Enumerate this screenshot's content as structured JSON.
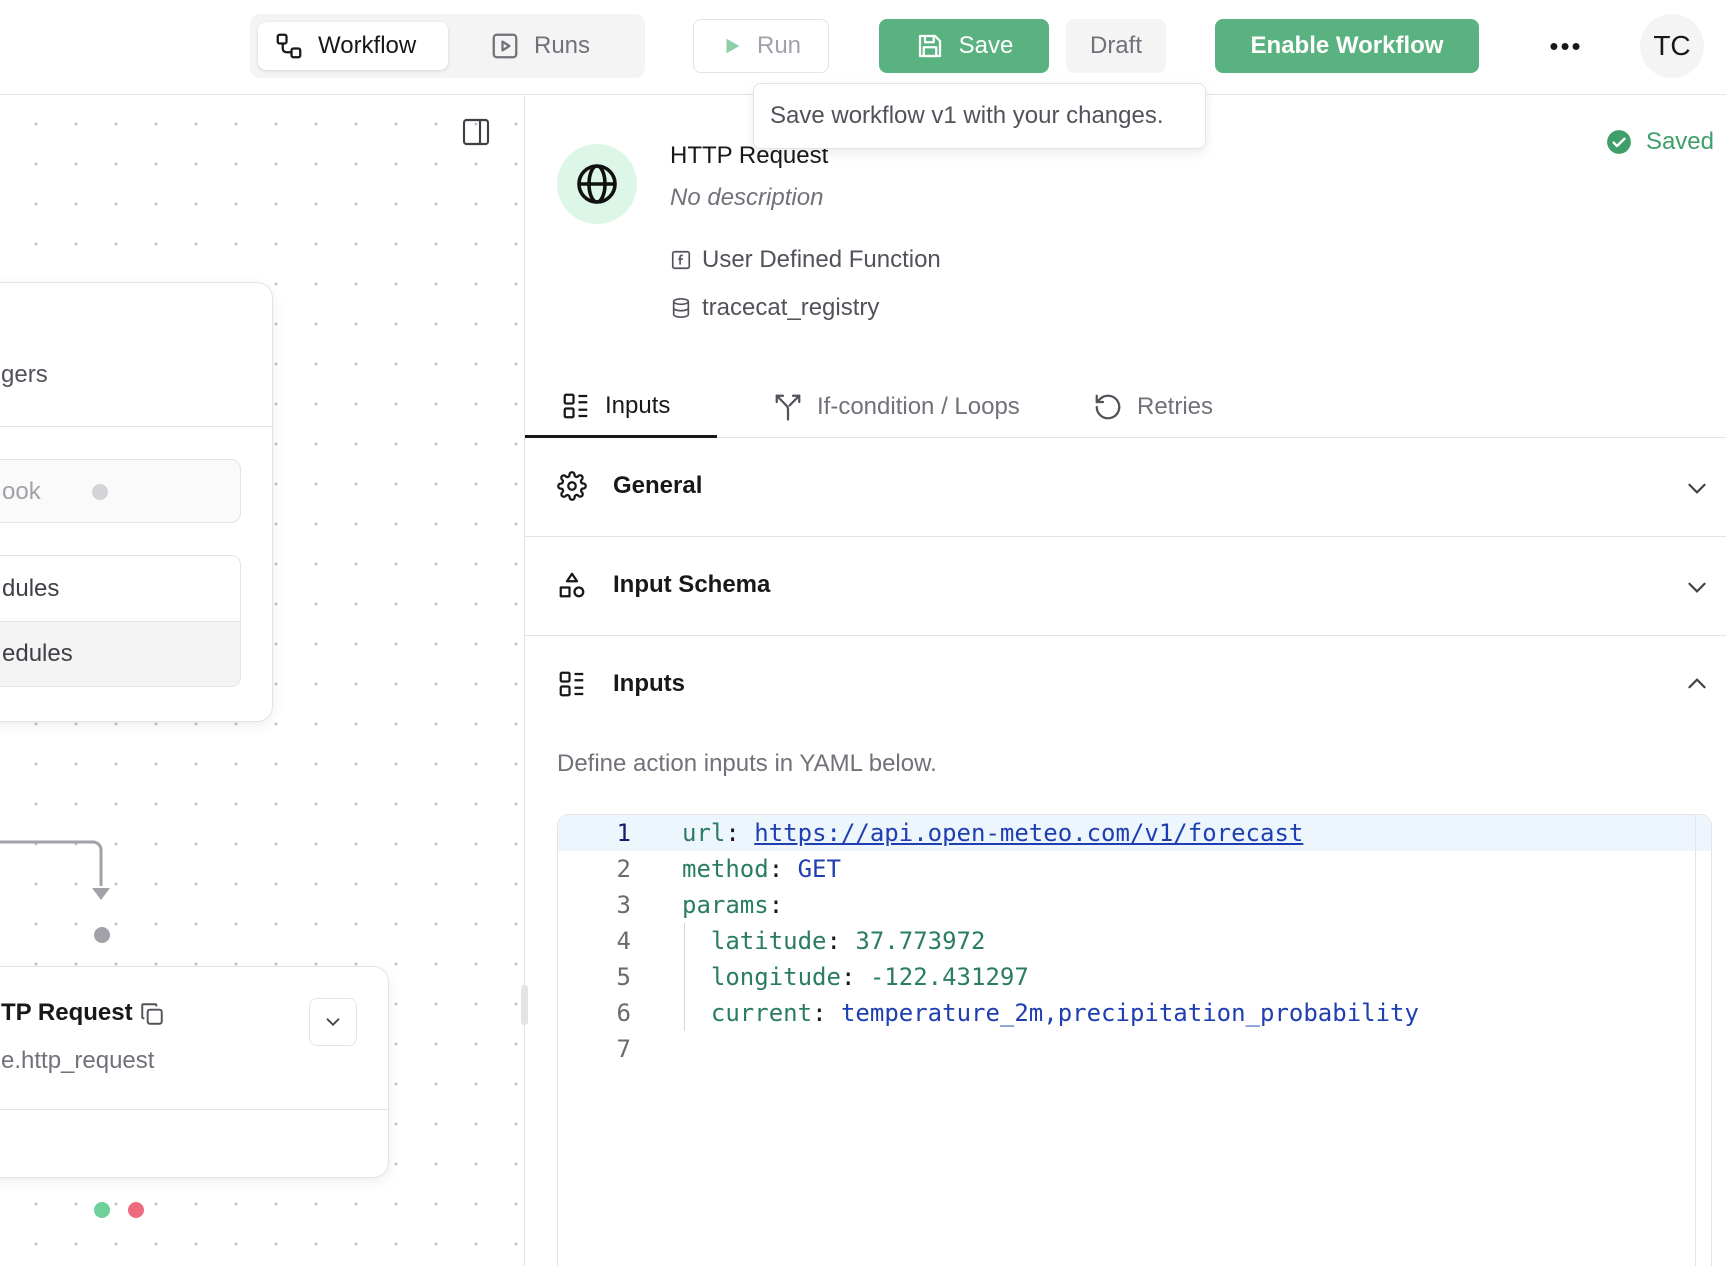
{
  "header": {
    "tabs": [
      {
        "label": "Workflow",
        "icon": "workflow-icon",
        "active": true
      },
      {
        "label": "Runs",
        "icon": "play-square-icon",
        "active": false
      }
    ],
    "run_label": "Run",
    "save_label": "Save",
    "draft_label": "Draft",
    "enable_label": "Enable Workflow",
    "more_label": "•••",
    "avatar_initials": "TC",
    "tooltip": "Save workflow v1 with your changes.",
    "accent_color": "#5bb281"
  },
  "canvas": {
    "trigger_node": {
      "label_partial": "gers",
      "webhook_partial": "ook",
      "schedule_rows": [
        "dules",
        "edules"
      ]
    },
    "action_node": {
      "title_partial": "TP Request",
      "subtitle_partial": "e.http_request"
    }
  },
  "panel": {
    "action": {
      "title": "HTTP Request",
      "description": "No description",
      "type_label": "User Defined Function",
      "registry": "tracecat_registry",
      "icon": "globe-icon"
    },
    "status": "Saved",
    "tabs": [
      {
        "label": "Inputs",
        "icon": "list-icon",
        "active": true
      },
      {
        "label": "If-condition / Loops",
        "icon": "split-icon",
        "active": false
      },
      {
        "label": "Retries",
        "icon": "rotate-icon",
        "active": false
      }
    ],
    "sections": [
      {
        "label": "General",
        "icon": "gear-icon",
        "expanded": false
      },
      {
        "label": "Input Schema",
        "icon": "shapes-icon",
        "expanded": false
      },
      {
        "label": "Inputs",
        "icon": "list-icon",
        "expanded": true
      }
    ],
    "inputs_help": "Define action inputs in YAML below.",
    "yaml": {
      "line_numbers": [
        "1",
        "2",
        "3",
        "4",
        "5",
        "6",
        "7"
      ],
      "url_key": "url",
      "url_value": "https://api.open-meteo.com/v1/forecast",
      "method_key": "method",
      "method_value": "GET",
      "params_key": "params",
      "lat_key": "latitude",
      "lat_value": "37.773972",
      "lon_key": "longitude",
      "lon_value": "-122.431297",
      "current_key": "current",
      "current_value": "temperature_2m,precipitation_probability"
    }
  }
}
